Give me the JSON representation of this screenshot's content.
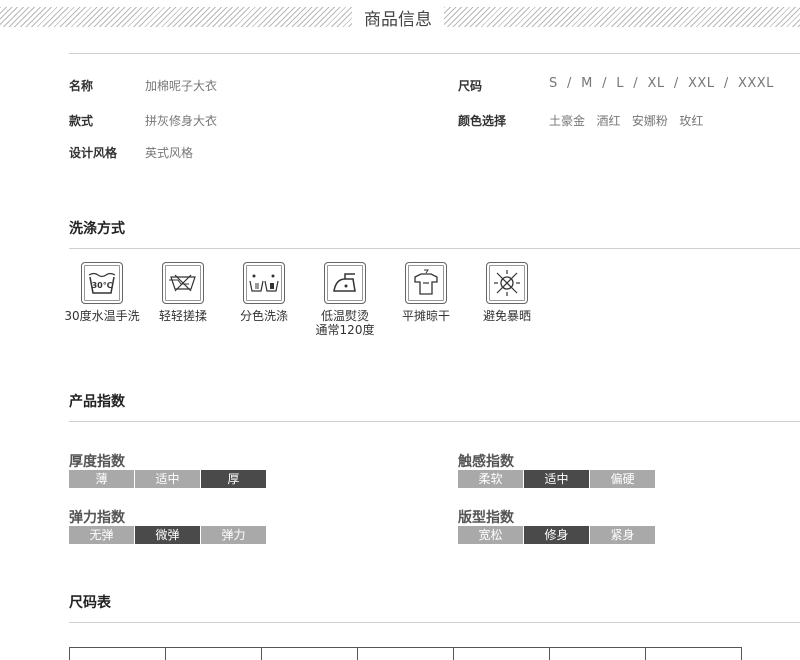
{
  "header": {
    "title": "商品信息"
  },
  "info": {
    "name_label": "名称",
    "name_value": "加棉呢子大衣",
    "style_label": "款式",
    "style_value": "拼灰修身大衣",
    "design_label": "设计风格",
    "design_value": "英式风格",
    "size_label": "尺码",
    "size_value": "S  /  M  /  L  /  XL  /  XXL  /  XXXL",
    "color_label": "颜色选择",
    "color_value": "土豪金   酒红   安娜粉   玫红"
  },
  "washing": {
    "title": "洗涤方式",
    "items": [
      {
        "icon": "hand-wash-30-icon",
        "line1": "30度水温手洗",
        "line2": ""
      },
      {
        "icon": "gentle-wash-icon",
        "line1": "轻轻搓揉",
        "line2": ""
      },
      {
        "icon": "separate-wash-icon",
        "line1": "分色洗涤",
        "line2": ""
      },
      {
        "icon": "low-iron-icon",
        "line1": "低温熨烫",
        "line2": "通常120度"
      },
      {
        "icon": "flat-dry-icon",
        "line1": "平摊晾干",
        "line2": ""
      },
      {
        "icon": "avoid-sun-icon",
        "line1": "避免暴晒",
        "line2": ""
      }
    ]
  },
  "product_index": {
    "title": "产品指数",
    "thickness": {
      "title": "厚度指数",
      "options": [
        "薄",
        "适中",
        "厚"
      ],
      "selected": 2
    },
    "touch": {
      "title": "触感指数",
      "options": [
        "柔软",
        "适中",
        "偏硬"
      ],
      "selected": 1
    },
    "elasticity": {
      "title": "弹力指数",
      "options": [
        "无弹",
        "微弹",
        "弹力"
      ],
      "selected": 1
    },
    "fit": {
      "title": "版型指数",
      "options": [
        "宽松",
        "修身",
        "紧身"
      ],
      "selected": 1
    }
  },
  "size_chart": {
    "title": "尺码表"
  },
  "colors": {
    "selected": "#4a4a4a",
    "unselected": "#a9a9a9"
  }
}
